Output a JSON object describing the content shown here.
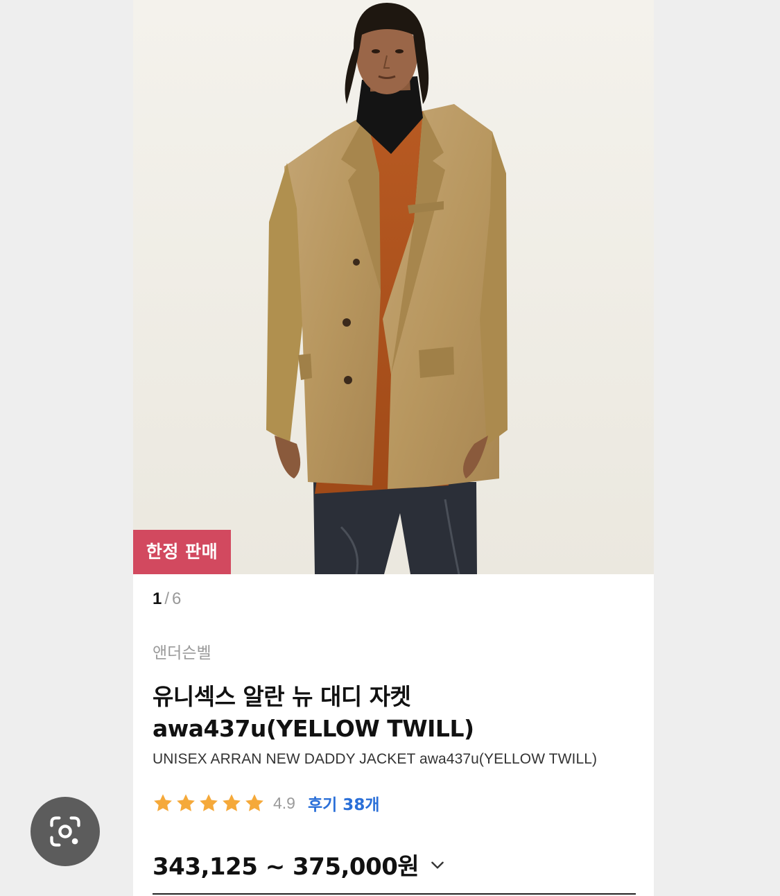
{
  "badge": {
    "label": "한정 판매"
  },
  "pager": {
    "current": "1",
    "separator": "/",
    "total": "6"
  },
  "product": {
    "brand": "앤더슨벨",
    "title": "유니섹스 알란 뉴 대디 자켓 awa437u(YELLOW TWILL)",
    "subtitle": "UNISEX ARRAN NEW DADDY JACKET awa437u(YELLOW TWILL)",
    "rating": {
      "stars": 5,
      "score": "4.9",
      "reviews_label": "후기 38개"
    },
    "price": "343,125 ~ 375,000원"
  },
  "colors": {
    "badge": "#d2495f",
    "star": "#f5a93a",
    "review_link": "#2a6fd8",
    "lens_button": "#5c5c5c"
  },
  "icons": {
    "photo": "product-photo",
    "star": "star-icon",
    "expand": "chevron-down-icon",
    "lens": "google-lens-icon"
  }
}
